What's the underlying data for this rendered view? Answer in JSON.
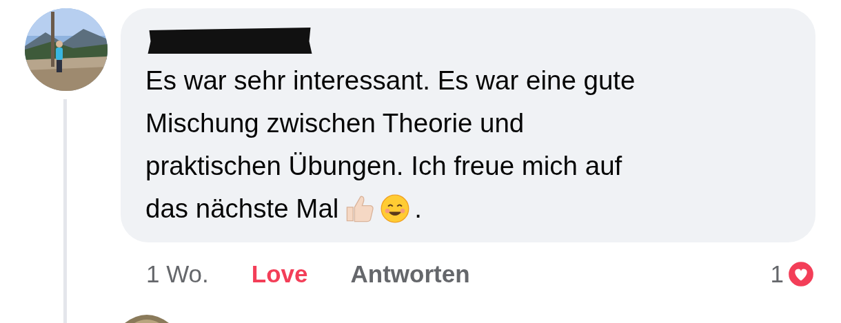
{
  "comment": {
    "lines": [
      "Es war sehr interessant. Es war eine gute",
      "Mischung zwischen Theorie und",
      "praktischen Übungen. Ich freue mich auf",
      "das nächste Mal"
    ],
    "end_mark": ".",
    "time": "1 Wo.",
    "reaction": {
      "label": "Love",
      "selected": true
    },
    "reply": {
      "label": "Antworten"
    },
    "reaction_count": "1"
  }
}
